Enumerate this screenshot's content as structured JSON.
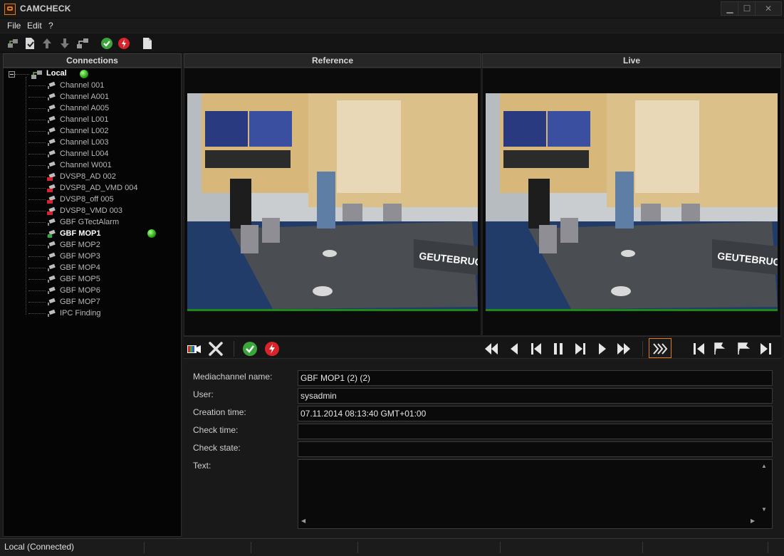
{
  "window": {
    "title": "CAMCHECK",
    "minimize": "▁",
    "maximize": "☐",
    "close": "✕"
  },
  "menu": [
    "File",
    "Edit",
    "?"
  ],
  "panels": {
    "connections": "Connections",
    "reference": "Reference",
    "live": "Live"
  },
  "tree": {
    "root": "Local",
    "items": [
      {
        "label": "Channel 001",
        "icon": "camera-icon"
      },
      {
        "label": "Channel A001",
        "icon": "camera-icon"
      },
      {
        "label": "Channel A005",
        "icon": "camera-icon"
      },
      {
        "label": "Channel L001",
        "icon": "camera-icon"
      },
      {
        "label": "Channel L002",
        "icon": "camera-icon"
      },
      {
        "label": "Channel L003",
        "icon": "camera-icon"
      },
      {
        "label": "Channel L004",
        "icon": "camera-icon"
      },
      {
        "label": "Channel W001",
        "icon": "camera-icon"
      },
      {
        "label": "DVSP8_AD 002",
        "icon": "camera-error-icon"
      },
      {
        "label": "DVSP8_AD_VMD 004",
        "icon": "camera-error-icon"
      },
      {
        "label": "DVSP8_off 005",
        "icon": "camera-error-icon"
      },
      {
        "label": "DVSP8_VMD 003",
        "icon": "camera-error-icon"
      },
      {
        "label": "GBF GTectAlarm",
        "icon": "camera-icon"
      },
      {
        "label": "GBF MOP1",
        "icon": "camera-ok-icon",
        "selected": true
      },
      {
        "label": "GBF MOP2",
        "icon": "camera-icon"
      },
      {
        "label": "GBF MOP3",
        "icon": "camera-icon"
      },
      {
        "label": "GBF MOP4",
        "icon": "camera-icon"
      },
      {
        "label": "GBF MOP5",
        "icon": "camera-icon"
      },
      {
        "label": "GBF MOP6",
        "icon": "camera-icon"
      },
      {
        "label": "GBF MOP7",
        "icon": "camera-icon"
      },
      {
        "label": "IPC Finding",
        "icon": "camera-icon"
      }
    ]
  },
  "video": {
    "overlay_text": "GEUTEBRUCK"
  },
  "details": {
    "mediachannel_label": "Mediachannel name:",
    "mediachannel_value": "GBF MOP1 (2) (2)",
    "user_label": "User:",
    "user_value": "sysadmin",
    "creation_label": "Creation time:",
    "creation_value": "07.11.2014 08:13:40 GMT+01:00",
    "checktime_label": "Check time:",
    "checktime_value": "",
    "checkstate_label": "Check state:",
    "checkstate_value": "",
    "text_label": "Text:",
    "text_value": ""
  },
  "status": {
    "connection": "Local (Connected)"
  },
  "colors": {
    "accent_orange": "#e07a20",
    "ok_green": "#3aa53a",
    "error_red": "#d8232a",
    "frame_green": "#1b8a1b"
  }
}
